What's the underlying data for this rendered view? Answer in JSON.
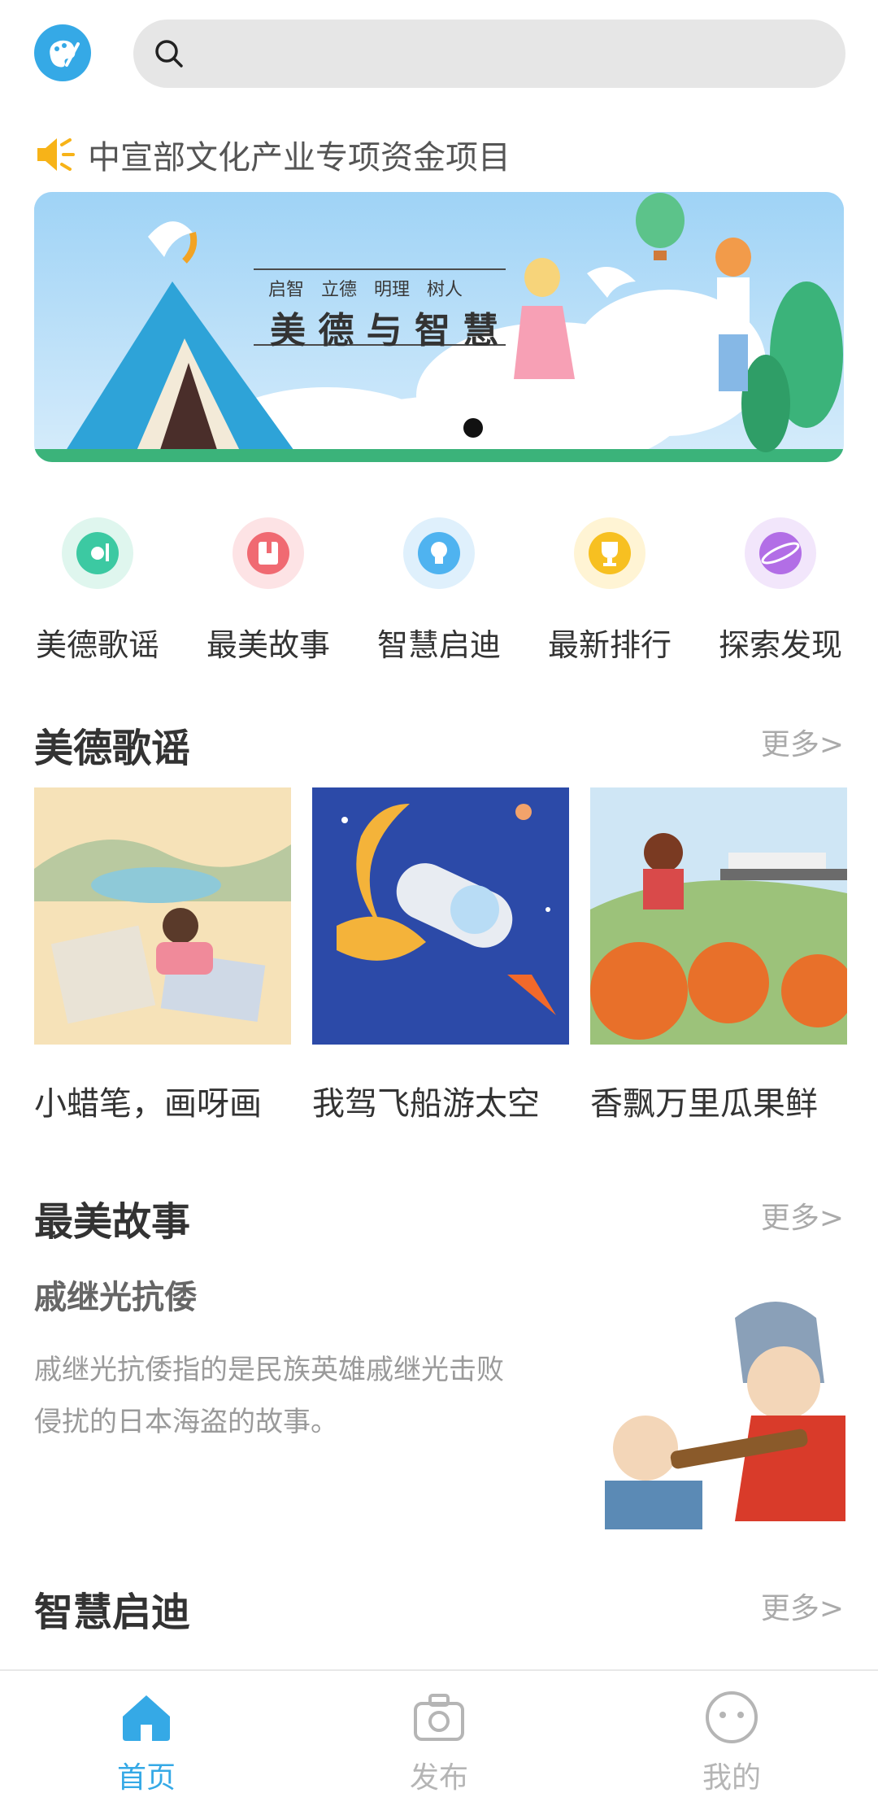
{
  "search": {
    "placeholder": ""
  },
  "notice": {
    "text": "中宣部文化产业专项资金项目"
  },
  "banner": {
    "subtitle": "启智   立德   明理   树人",
    "title": "美 德 与 智 慧"
  },
  "categories": [
    {
      "label": "美德歌谣",
      "icon": "music-icon",
      "color": "#3cc9a2"
    },
    {
      "label": "最美故事",
      "icon": "book-icon",
      "color": "#f06a72"
    },
    {
      "label": "智慧启迪",
      "icon": "lightbulb-icon",
      "color": "#4fb3f0"
    },
    {
      "label": "最新排行",
      "icon": "trophy-icon",
      "color": "#f7c021"
    },
    {
      "label": "探索发现",
      "icon": "planet-icon",
      "color": "#b26ee6"
    }
  ],
  "sections": {
    "songs": {
      "title": "美德歌谣",
      "more": "更多>"
    },
    "stories": {
      "title": "最美故事",
      "more": "更多>"
    },
    "wisdom": {
      "title": "智慧启迪",
      "more": "更多>"
    }
  },
  "songs": [
    {
      "name": "小蜡笔，画呀画"
    },
    {
      "name": "我驾飞船游太空"
    },
    {
      "name": "香飘万里瓜果鲜"
    }
  ],
  "story": {
    "title": "戚继光抗倭",
    "desc": "戚继光抗倭指的是民族英雄戚继光击败侵扰的日本海盗的故事。"
  },
  "tabs": [
    {
      "label": "首页",
      "active": true,
      "color": "#35a9e6"
    },
    {
      "label": "发布",
      "active": false,
      "color": "#b5b5b5"
    },
    {
      "label": "我的",
      "active": false,
      "color": "#b5b5b5"
    }
  ]
}
